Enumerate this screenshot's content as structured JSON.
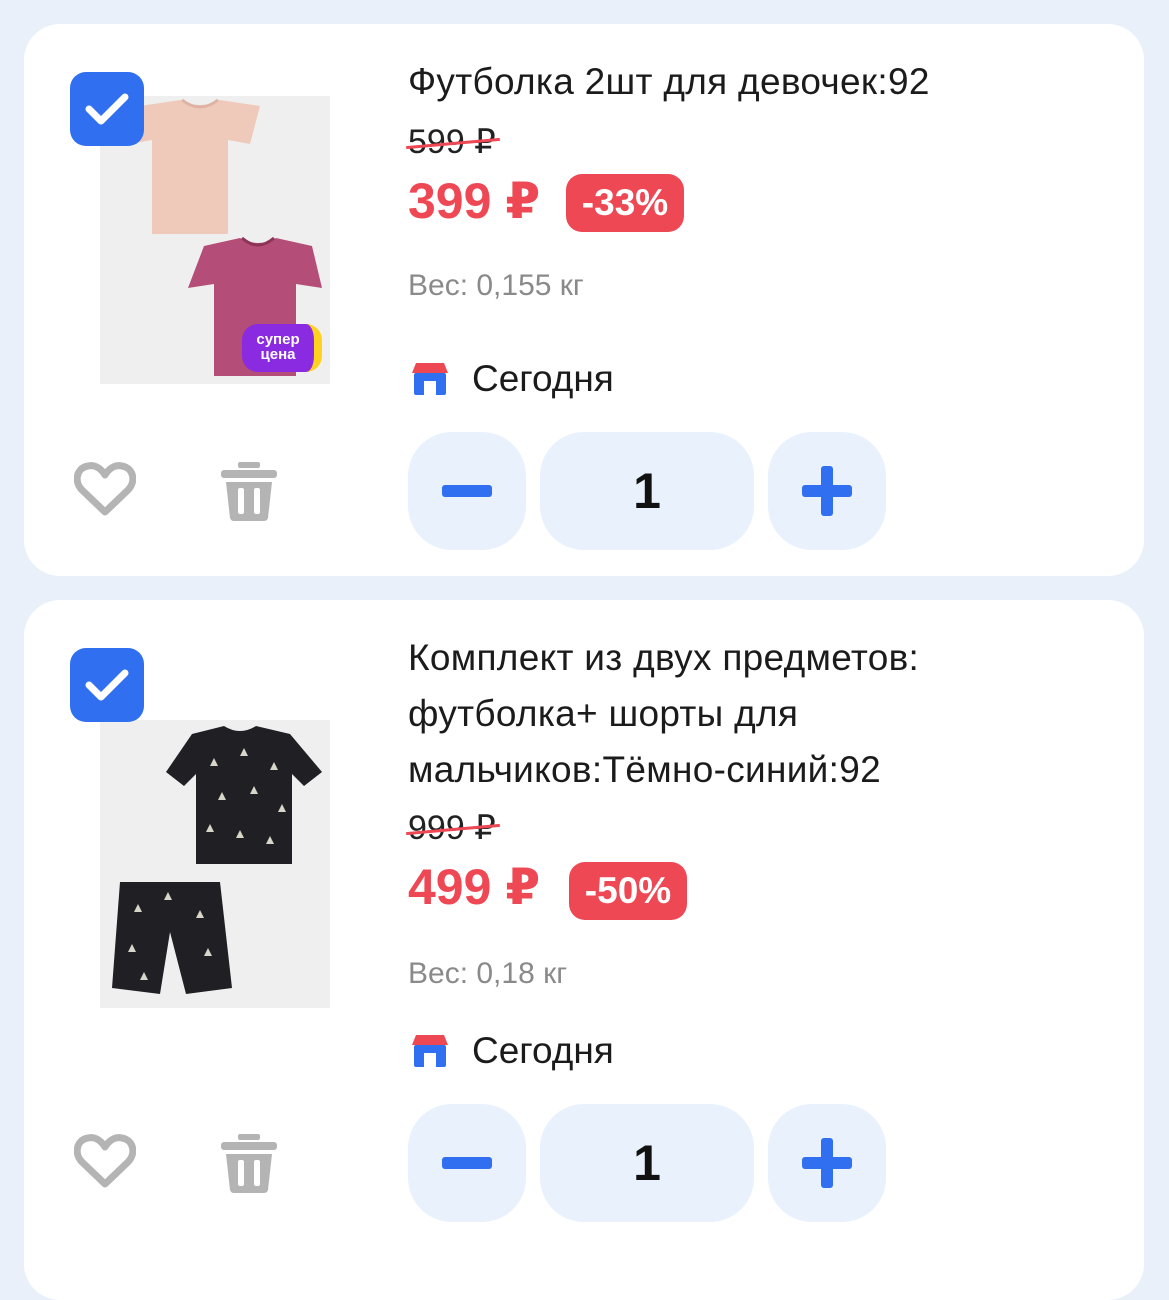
{
  "items": [
    {
      "title": "Футболка 2шт для девочек:92",
      "old_price": "599 ₽",
      "price": "399 ₽",
      "discount": "-33%",
      "weight": "Вес: 0,155 кг",
      "delivery": "Сегодня",
      "quantity": "1",
      "badge_line1": "супер",
      "badge_line2": "цена",
      "checked": true
    },
    {
      "title": "Комплект из двух предметов: футболка+ шорты для мальчиков:Тёмно-синий:92",
      "old_price": "999 ₽",
      "price": "499 ₽",
      "discount": "-50%",
      "weight": "Вес: 0,18 кг",
      "delivery": "Сегодня",
      "quantity": "1",
      "checked": true
    }
  ],
  "colors": {
    "background": "#e9f0fa",
    "accent_blue": "#2f6ff0",
    "sale_red": "#ef4855",
    "stepper_bg": "#e9f1fd",
    "muted_gray": "#8a8a8a",
    "icon_gray": "#b4b4b4",
    "badge_purple": "#8a2be2",
    "badge_yellow": "#ffd21f"
  },
  "icons": {
    "checkbox": "checkmark-icon",
    "favorite": "heart-icon",
    "delete": "trash-icon",
    "store": "store-icon",
    "decrease": "minus-icon",
    "increase": "plus-icon"
  }
}
